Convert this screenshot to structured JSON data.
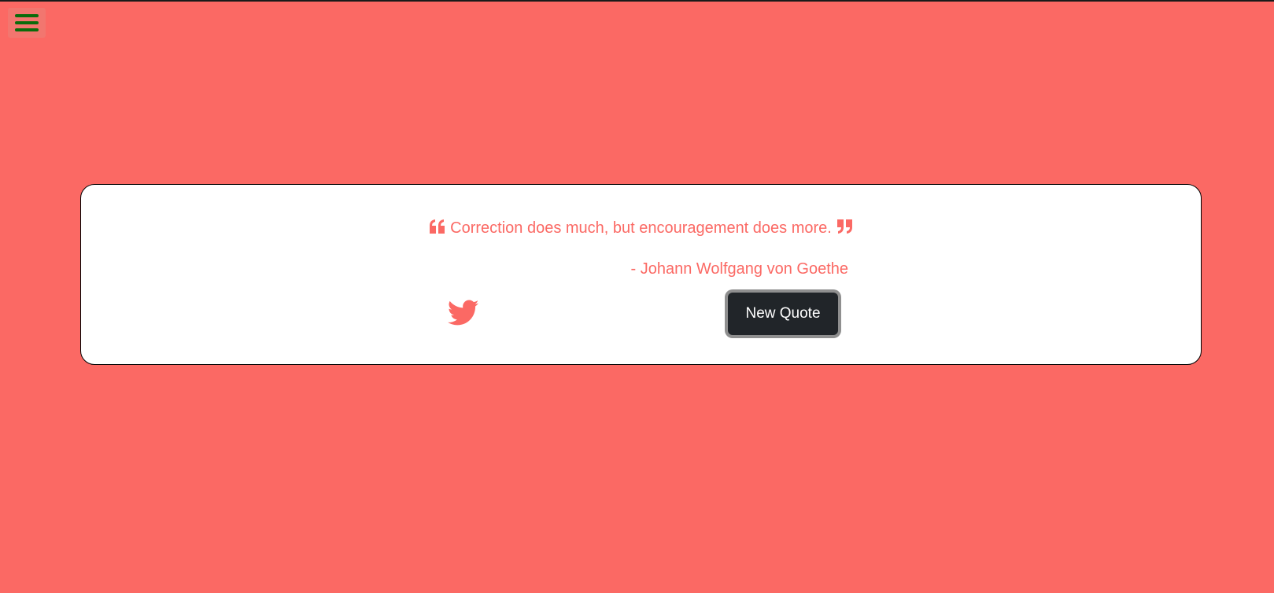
{
  "colors": {
    "background": "#FB6964",
    "accent": "#FB6964",
    "card": "#FFFFFF",
    "button": "#212529",
    "menu_icon": "#0A6B0A"
  },
  "nav": {
    "menu_icon": "hamburger-menu-icon"
  },
  "quote": {
    "text": "Correction does much, but encouragement does more.",
    "author": "- Johann Wolfgang von Goethe",
    "open_icon": "quote-left-icon",
    "close_icon": "quote-right-icon"
  },
  "actions": {
    "tweet_icon": "twitter-icon",
    "new_quote_label": "New Quote"
  }
}
